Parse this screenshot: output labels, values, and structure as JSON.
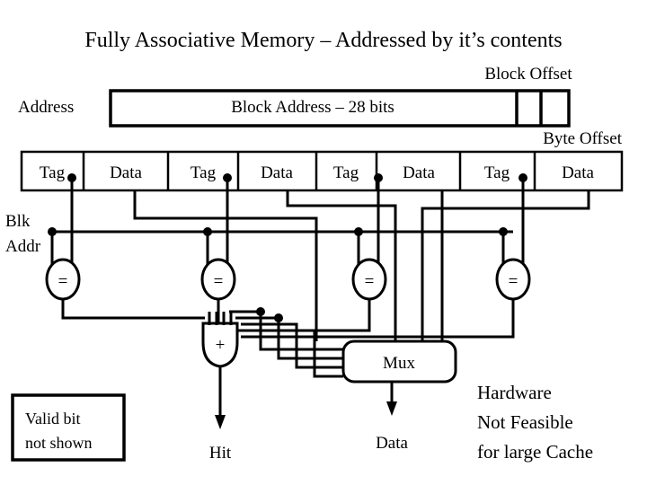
{
  "title": "Fully Associative Memory – Addressed by it’s contents",
  "address_row": {
    "label": "Address",
    "block_address_field": "Block Address – 28 bits",
    "block_offset_label": "Block Offset",
    "byte_offset_label": "Byte Offset"
  },
  "memory_table": {
    "cells": [
      {
        "kind": "tag",
        "label": "Tag"
      },
      {
        "kind": "data",
        "label": "Data"
      },
      {
        "kind": "tag",
        "label": "Tag"
      },
      {
        "kind": "data",
        "label": "Data"
      },
      {
        "kind": "tag",
        "label": "Tag"
      },
      {
        "kind": "data",
        "label": "Data"
      },
      {
        "kind": "tag",
        "label": "Tag"
      },
      {
        "kind": "data",
        "label": "Data"
      }
    ]
  },
  "bus": {
    "line1": "Blk",
    "line2": "Addr"
  },
  "comparators": [
    {
      "symbol": "="
    },
    {
      "symbol": "="
    },
    {
      "symbol": "="
    },
    {
      "symbol": "="
    }
  ],
  "or_gate": {
    "symbol": "+"
  },
  "mux": {
    "label": "Mux"
  },
  "outputs": {
    "hit": "Hit",
    "data": "Data"
  },
  "valid_note": {
    "line1": "Valid bit",
    "line2": "not shown"
  },
  "hardware_note": {
    "line1": "Hardware",
    "line2": "Not Feasible",
    "line3": "for large Cache"
  },
  "colors": {
    "ink": "#000000",
    "paper": "#ffffff"
  }
}
